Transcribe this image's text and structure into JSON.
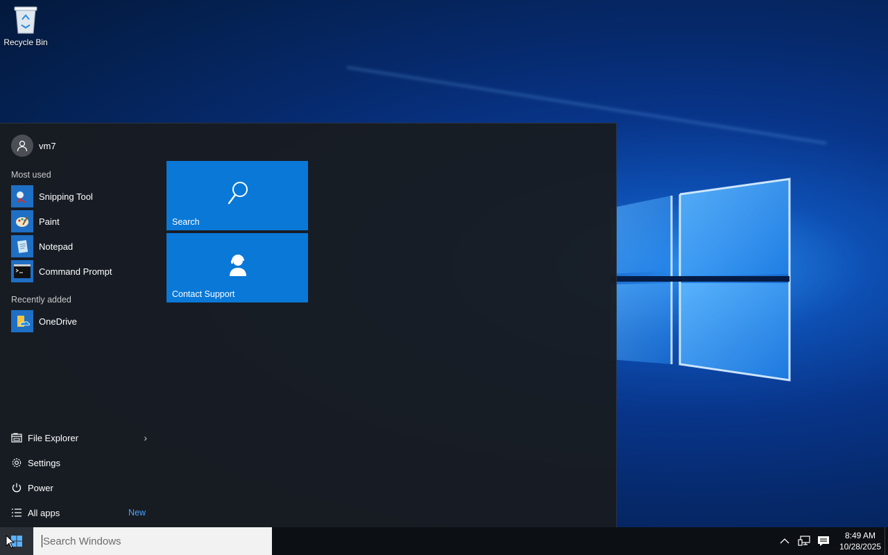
{
  "desktop": {
    "icons": [
      {
        "label": "Recycle Bin",
        "icon": "recycle-bin-icon"
      }
    ]
  },
  "start_menu": {
    "user": {
      "name": "vm7",
      "icon": "user-avatar-icon"
    },
    "most_used_label": "Most used",
    "most_used": [
      {
        "label": "Snipping Tool",
        "icon": "snipping-tool-icon"
      },
      {
        "label": "Paint",
        "icon": "paint-icon"
      },
      {
        "label": "Notepad",
        "icon": "notepad-icon"
      },
      {
        "label": "Command Prompt",
        "icon": "command-prompt-icon"
      }
    ],
    "recently_added_label": "Recently added",
    "recently_added": [
      {
        "label": "OneDrive",
        "icon": "onedrive-icon"
      }
    ],
    "bottom": [
      {
        "label": "File Explorer",
        "icon": "file-explorer-icon",
        "chevron": "›"
      },
      {
        "label": "Settings",
        "icon": "gear-icon"
      },
      {
        "label": "Power",
        "icon": "power-icon"
      },
      {
        "label": "All apps",
        "icon": "all-apps-icon",
        "badge": "New"
      }
    ],
    "tiles": [
      {
        "label": "Search",
        "icon": "search-icon"
      },
      {
        "label": "Contact Support",
        "icon": "contact-support-icon"
      }
    ],
    "tile_color": "#0a78d7"
  },
  "taskbar": {
    "search": {
      "placeholder": "Search Windows"
    },
    "clock": {
      "time": "8:49 AM",
      "date": "10/28/2025"
    },
    "tray_icons": [
      "chevron-up-icon",
      "network-icon",
      "action-center-icon"
    ]
  }
}
